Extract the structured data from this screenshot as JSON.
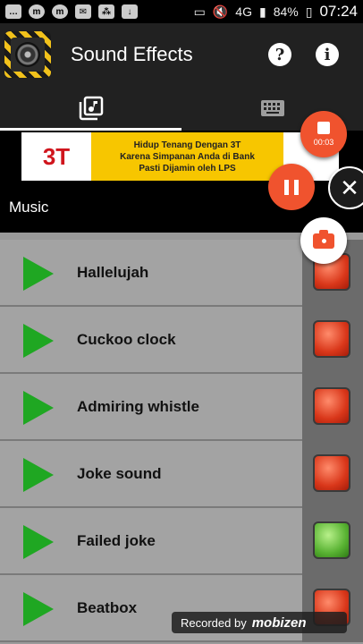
{
  "status_bar": {
    "network": "4G",
    "battery": "84%",
    "time": "07:24",
    "left_icons": [
      "chat-icon",
      "messenger-icon",
      "messenger-icon",
      "mail-icon",
      "bbm-icon",
      "download-icon"
    ],
    "right_icons": [
      "cast-icon",
      "mute-icon",
      "signal-icon",
      "battery-icon"
    ]
  },
  "app_bar": {
    "title": "Sound Effects",
    "help_label": "?",
    "info_label": "i"
  },
  "tabs": [
    {
      "icon": "music-library-icon",
      "active": true
    },
    {
      "icon": "keyboard-icon",
      "active": false
    }
  ],
  "ad": {
    "brand": "3T",
    "line1": "Hidup Tenang Dengan 3T",
    "line2": "Karena Simpanan Anda di Bank",
    "line3": "Pasti Dijamin oleh LPS"
  },
  "section": {
    "title": "Music"
  },
  "sounds": [
    {
      "name": "Hallelujah",
      "state": "red"
    },
    {
      "name": "Cuckoo clock",
      "state": "red"
    },
    {
      "name": "Admiring whistle",
      "state": "red"
    },
    {
      "name": "Joke sound",
      "state": "red"
    },
    {
      "name": "Failed joke",
      "state": "green"
    },
    {
      "name": "Beatbox",
      "state": "red"
    }
  ],
  "recorder": {
    "timer": "00:03",
    "close_label": "✕"
  },
  "watermark": {
    "text": "Recorded by",
    "brand": "mobizen"
  },
  "colors": {
    "accent": "#f0532e",
    "play": "#1fa722",
    "app_bar": "#212121"
  }
}
